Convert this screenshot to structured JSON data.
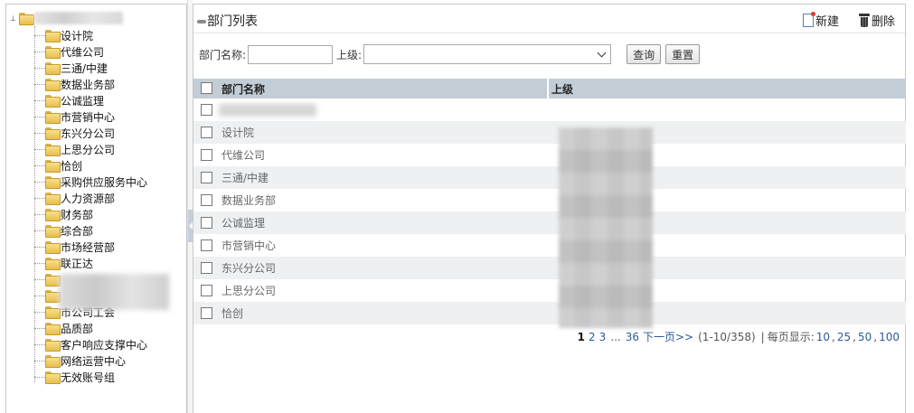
{
  "tree": {
    "items": [
      {
        "label": "设计院"
      },
      {
        "label": "代维公司"
      },
      {
        "label": "三通/中建"
      },
      {
        "label": "数据业务部"
      },
      {
        "label": "公诚监理"
      },
      {
        "label": "市营销中心"
      },
      {
        "label": "东兴分公司"
      },
      {
        "label": "上思分公司"
      },
      {
        "label": "恰创"
      },
      {
        "label": "采购供应服务中心"
      },
      {
        "label": "人力资源部"
      },
      {
        "label": "财务部"
      },
      {
        "label": "综合部"
      },
      {
        "label": "市场经营部"
      },
      {
        "label": "联正达"
      },
      {
        "label": ""
      },
      {
        "label": ""
      },
      {
        "label": "市公司工会"
      },
      {
        "label": "品质部"
      },
      {
        "label": "客户响应支撑中心"
      },
      {
        "label": "网络运营中心"
      },
      {
        "label": "无效账号组"
      }
    ]
  },
  "header": {
    "title": "部门列表",
    "new_label": "新建",
    "delete_label": "删除"
  },
  "search": {
    "name_label": "部门名称:",
    "name_value": "",
    "parent_label": "上级:",
    "parent_value": "",
    "query_label": "查询",
    "reset_label": "重置"
  },
  "table": {
    "columns": [
      "部门名称",
      "上级"
    ],
    "rows": [
      {
        "name": ""
      },
      {
        "name": "设计院"
      },
      {
        "name": "代维公司"
      },
      {
        "name": "三通/中建"
      },
      {
        "name": "数据业务部"
      },
      {
        "name": "公诚监理"
      },
      {
        "name": "市营销中心"
      },
      {
        "name": "东兴分公司"
      },
      {
        "name": "上思分公司"
      },
      {
        "name": "恰创"
      }
    ]
  },
  "pager": {
    "current": "1",
    "page2": "2",
    "page3": "3",
    "ellipsis": "...",
    "last": "36",
    "next": "下一页>>",
    "range": "(1-10/358)",
    "sep": "|",
    "per_page_label": "每页显示:",
    "size1": "10",
    "size2": "25",
    "size3": "50",
    "size4": "100"
  }
}
